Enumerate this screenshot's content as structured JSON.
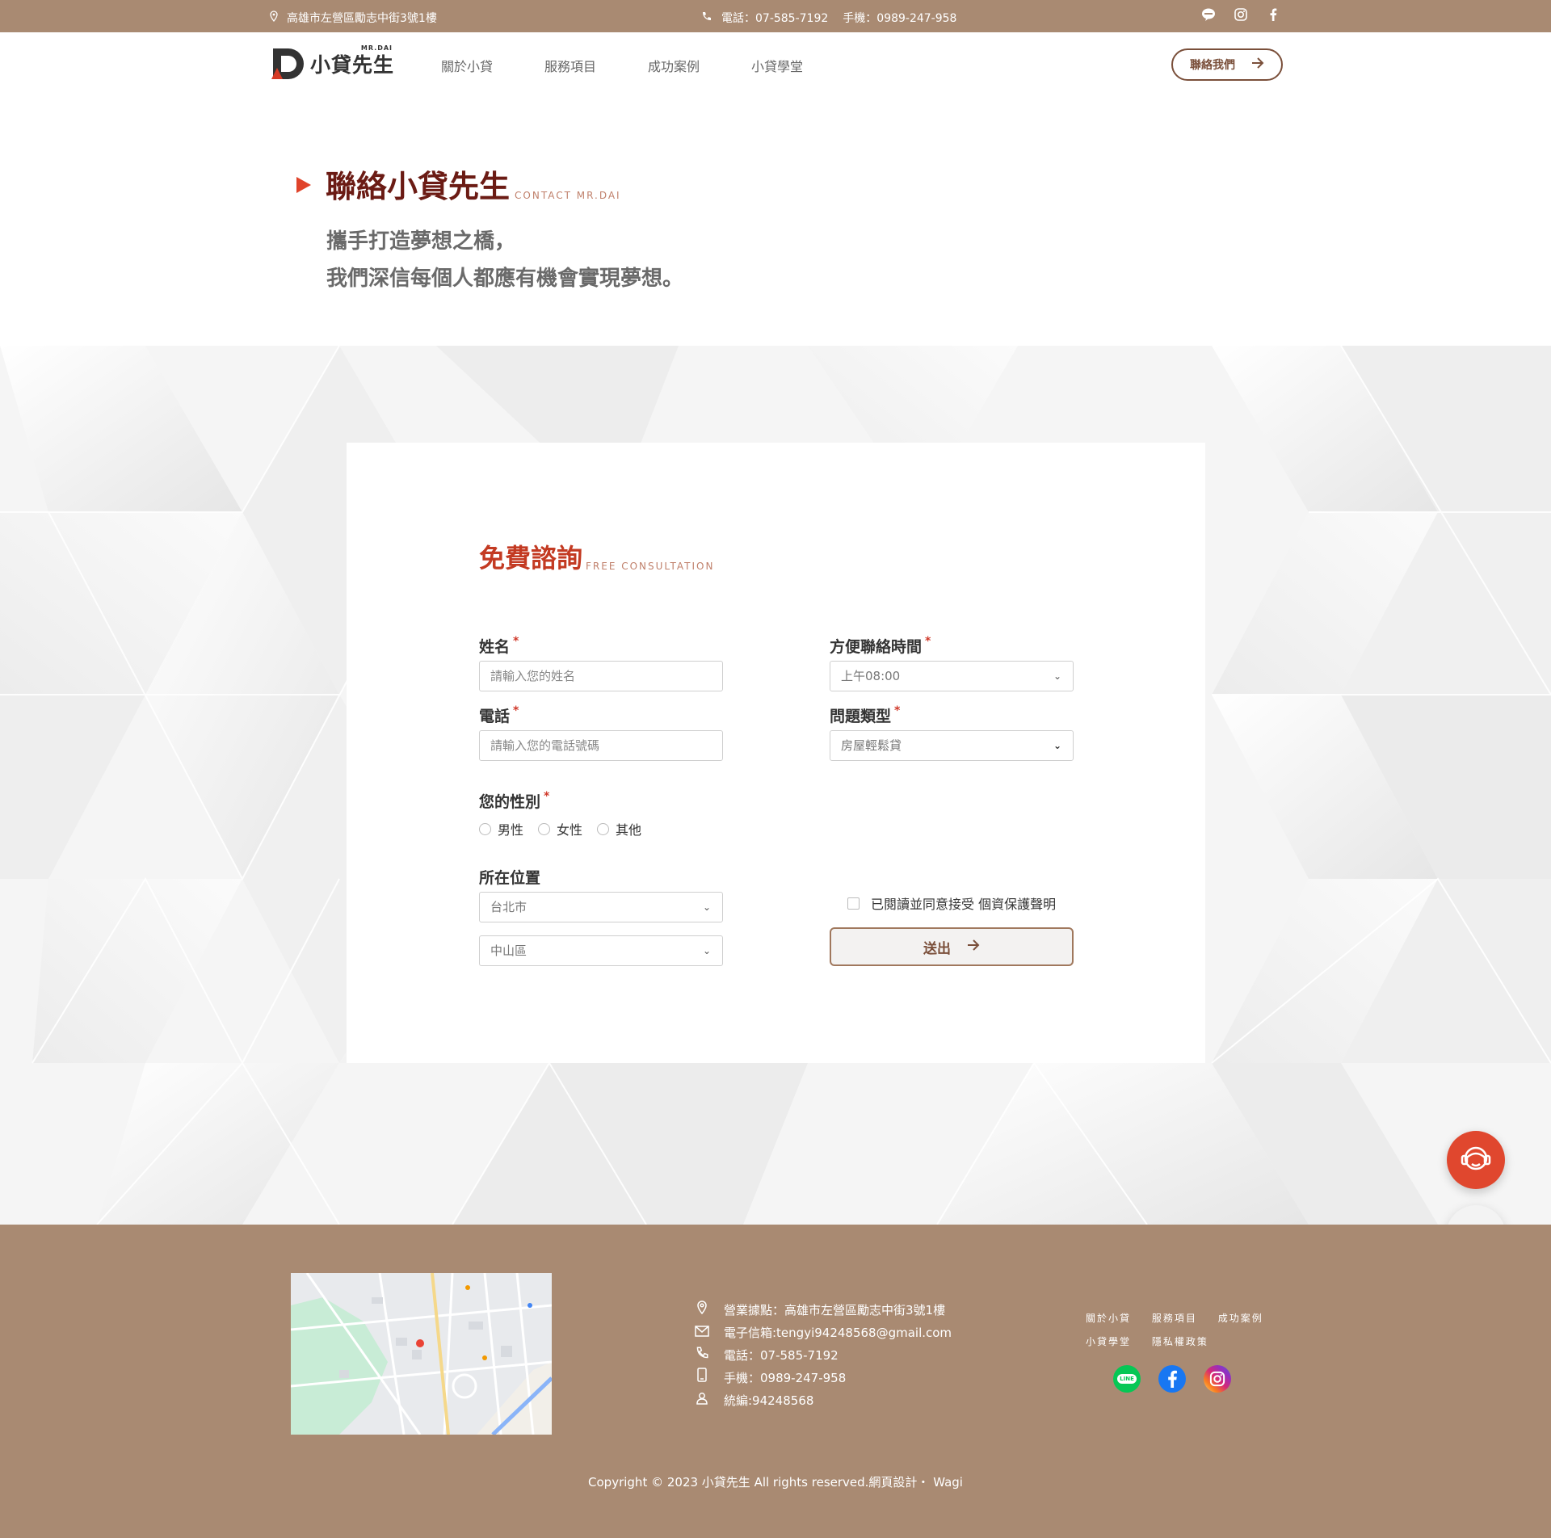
{
  "topbar": {
    "address": "高雄市左營區勵志中街3號1樓",
    "phone": "電話：07-585-7192",
    "mobile": "手機：0989-247-958",
    "social": [
      "line-icon",
      "instagram-icon",
      "facebook-icon"
    ]
  },
  "header": {
    "logo_text": "小貸先生",
    "logo_small": "MR.DAI",
    "nav": [
      "關於小貸",
      "服務項目",
      "成功案例",
      "小貸學堂"
    ],
    "contact_button": "聯絡我們"
  },
  "hero": {
    "title": "聯絡小貸先生",
    "subtitle": "CONTACT MR.DAI",
    "line1": "攜手打造夢想之橋，",
    "line2": "我們深信每個人都應有機會實現夢想。"
  },
  "form": {
    "title": "免費諮詢",
    "subtitle": "FREE CONSULTATION",
    "name_label": "姓名",
    "name_placeholder": "請輸入您的姓名",
    "phone_label": "電話",
    "phone_placeholder": "請輸入您的電話號碼",
    "time_label": "方便聯絡時間",
    "time_value": "上午08:00",
    "type_label": "問題類型",
    "type_value": "房屋輕鬆貸",
    "gender_label": "您的性別",
    "gender_options": [
      "男性",
      "女性",
      "其他"
    ],
    "location_label": "所在位置",
    "city_value": "台北市",
    "district_value": "中山區",
    "agree_text": "已閱讀並同意接受 個資保護聲明",
    "submit_label": "送出",
    "required_mark": "*"
  },
  "footer": {
    "address": "營業據點：高雄市左營區勵志中街3號1樓",
    "email": "電子信箱:tengyi94248568@gmail.com",
    "phone": "電話：07-585-7192",
    "mobile": "手機：0989-247-958",
    "tax_id": "統編:94248568",
    "links_row1": [
      "關於小貸",
      "服務項目",
      "成功案例"
    ],
    "links_row2": [
      "小貸學堂",
      "隱私權政策"
    ],
    "social": [
      "line-icon",
      "facebook-icon",
      "instagram-icon"
    ],
    "line_badge": "LINE",
    "copyright": "Copyright © 2023 小貸先生 All rights reserved.網頁設計・ Wagi"
  },
  "colors": {
    "brand_brown": "#a98a72",
    "accent_red": "#e0472e",
    "title_dark_red": "#6b1b14"
  }
}
